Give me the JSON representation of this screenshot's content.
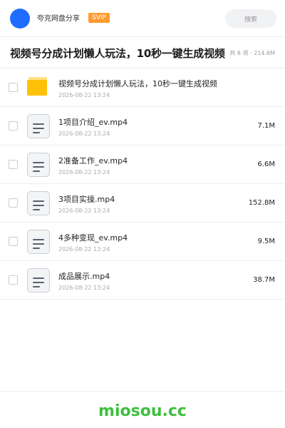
{
  "header": {
    "share_name": "夸克网盘分享",
    "badge": "SVIP",
    "search_placeholder": "搜索"
  },
  "folder_bar": {
    "title": "视频号分成计划懒人玩法，10秒一键生成视频",
    "summary": "共 6 项 · 214.6M"
  },
  "files": [
    {
      "name": "视频号分成计划懒人玩法，10秒一键生成视频",
      "date": "2026-08-22 13:24",
      "size": "",
      "type": "folder"
    },
    {
      "name": "1项目介绍_ev.mp4",
      "date": "2026-08-22 13:24",
      "size": "7.1M",
      "type": "file"
    },
    {
      "name": "2准备工作_ev.mp4",
      "date": "2026-08-22 13:24",
      "size": "6.6M",
      "type": "file"
    },
    {
      "name": "3项目实操.mp4",
      "date": "2026-08-22 13:24",
      "size": "152.8M",
      "type": "file"
    },
    {
      "name": "4多种变现_ev.mp4",
      "date": "2026-08-22 13:24",
      "size": "9.5M",
      "type": "file"
    },
    {
      "name": "成品展示.mp4",
      "date": "2026-08-22 13:24",
      "size": "38.7M",
      "type": "file"
    }
  ],
  "footer": {
    "watermark": "miosou.cc"
  },
  "colors": {
    "accent": "#1f6dff",
    "svip": "#ff9a2e",
    "folder": "#ffc107",
    "watermark": "#3fbf3f"
  }
}
